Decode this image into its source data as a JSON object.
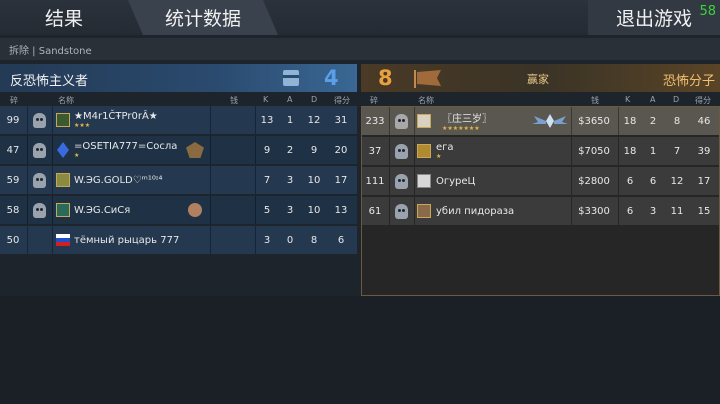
{
  "tabs": {
    "results": "结果",
    "stats": "统计数据",
    "exit": "退出游戏"
  },
  "fps": "58",
  "map_label": "拆除 | Sandstone",
  "ct": {
    "name": "反恐怖主义者",
    "score": "4",
    "headers": {
      "ping": "碎",
      "name": "名称",
      "money": "钱",
      "k": "K",
      "a": "A",
      "d": "D",
      "score": "得分"
    },
    "players": [
      {
        "ping": "99",
        "name": "★M4r1ČŦPr0rÂ★",
        "stars": "★★★",
        "k": "13",
        "a": "1",
        "d": "12",
        "score": "31"
      },
      {
        "ping": "47",
        "name": "=OSETIA777=Сосла",
        "stars": "★",
        "k": "9",
        "a": "2",
        "d": "9",
        "score": "20"
      },
      {
        "ping": "59",
        "name": "W.ЭG.GOLD♡ᵐ¹⁰ᶦ⁴",
        "stars": "",
        "k": "7",
        "a": "3",
        "d": "10",
        "score": "17"
      },
      {
        "ping": "58",
        "name": "W.ЭG.СиСя",
        "stars": "",
        "k": "5",
        "a": "3",
        "d": "10",
        "score": "13"
      },
      {
        "ping": "50",
        "name": "тёмный рыцарь 777",
        "stars": "",
        "k": "3",
        "a": "0",
        "d": "8",
        "score": "6"
      }
    ]
  },
  "t": {
    "name": "恐怖分子",
    "score": "8",
    "winner": "赢家",
    "headers": {
      "ping": "碎",
      "name": "名称",
      "money": "钱",
      "k": "K",
      "a": "A",
      "d": "D",
      "score": "得分"
    },
    "players": [
      {
        "ping": "233",
        "name": "〖庄三岁〗",
        "stars": "★★★★★★★",
        "money": "$3650",
        "k": "18",
        "a": "2",
        "d": "8",
        "score": "46"
      },
      {
        "ping": "37",
        "name": "ега",
        "stars": "★",
        "money": "$7050",
        "k": "18",
        "a": "1",
        "d": "7",
        "score": "39"
      },
      {
        "ping": "111",
        "name": "ОгуреЦ",
        "stars": "",
        "money": "$2800",
        "k": "6",
        "a": "6",
        "d": "12",
        "score": "17"
      },
      {
        "ping": "61",
        "name": "убил пидораза",
        "stars": "",
        "money": "$3300",
        "k": "6",
        "a": "3",
        "d": "11",
        "score": "15"
      }
    ]
  },
  "colors": {
    "ct_score": "#5aa0e8",
    "t_score": "#e8a040",
    "fps": "#3ad43a"
  }
}
